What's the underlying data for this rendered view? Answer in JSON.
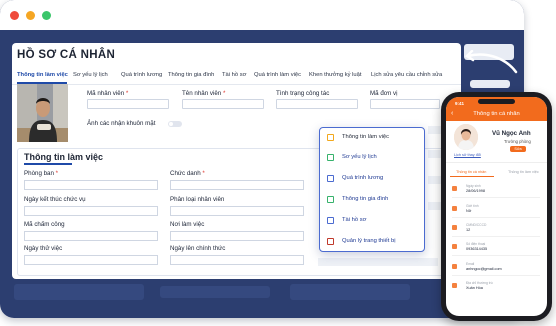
{
  "page": {
    "title": "HỒ SƠ CÁ NHÂN"
  },
  "tabs": [
    {
      "label": "Thông tin làm việc",
      "active": true
    },
    {
      "label": "Sơ yếu lý lịch"
    },
    {
      "label": "Quá trình lương"
    },
    {
      "label": "Thông tin gia đình"
    },
    {
      "label": "Tài hồ sơ"
    },
    {
      "label": "Quá trình làm việc"
    },
    {
      "label": "Khen thưởng kỷ luật"
    },
    {
      "label": "Lịch sửa yêu cầu chỉnh sửa"
    }
  ],
  "profile": {
    "employee_code_label": "Mã nhân viên",
    "employee_name_label": "Tên nhân viên",
    "status_label": "Tình trạng công tác",
    "unit_code_label": "Mã đơn vị",
    "face_photo_label": "Ảnh các nhận khuôn mặt",
    "required_mark": "*"
  },
  "work_section": {
    "title": "Thông tin làm việc",
    "fields": {
      "department": "Phòng ban",
      "title": "Chức danh",
      "end_date": "Ngày kết thúc chức vụ",
      "employee_type": "Phân loại nhân viên",
      "timekeeping_code": "Mã chấm công",
      "workplace": "Nơi làm việc",
      "probation_date": "Ngày thử việc",
      "official_date": "Ngày lên chính thức"
    }
  },
  "menu": {
    "items": [
      {
        "label": "Thông tin làm việc",
        "icon": "briefcase-icon",
        "color": "#f2a81d"
      },
      {
        "label": "Sơ yếu lý lịch",
        "icon": "profile-icon",
        "color": "#37b26c"
      },
      {
        "label": "Quá trình lương",
        "icon": "salary-icon",
        "color": "#4b6bd0"
      },
      {
        "label": "Thông tin gia đình",
        "icon": "family-icon",
        "color": "#37b26c"
      },
      {
        "label": "Tài hồ sơ",
        "icon": "file-icon",
        "color": "#4b6bd0"
      },
      {
        "label": "Quản lý trang thiết bị",
        "icon": "device-icon",
        "color": "#c0392b"
      }
    ]
  },
  "phone": {
    "time": "9:41",
    "header_title": "Thông tin cá nhân",
    "name": "Vũ Ngọc Anh",
    "role": "Trưởng phòng",
    "edit_button": "Sửa",
    "history_link": "Lịch sử thay đổi",
    "tab_info": "Thông tin cá nhân",
    "tab_work": "Thông tin làm việc",
    "rows": [
      {
        "label": "Ngày sinh",
        "value": "28/06/1998",
        "icon": "calendar-icon"
      },
      {
        "label": "Giới tính",
        "value": "Nữ",
        "icon": "gender-icon"
      },
      {
        "label": "CMND/CCCD",
        "value": "12",
        "icon": "id-card-icon"
      },
      {
        "label": "Số điện thoại",
        "value": "0936314435",
        "icon": "phone-icon"
      },
      {
        "label": "Email",
        "value": "anhngoc@gmail.com",
        "icon": "email-icon"
      },
      {
        "label": "Địa chỉ thường trú",
        "value": "Xuân Hòa",
        "icon": "location-icon"
      }
    ]
  },
  "colors": {
    "navy_frame": "#2c3e70",
    "accent_blue": "#1f4aa8",
    "phone_orange": "#f26b1d",
    "required_red": "#e0362e"
  }
}
